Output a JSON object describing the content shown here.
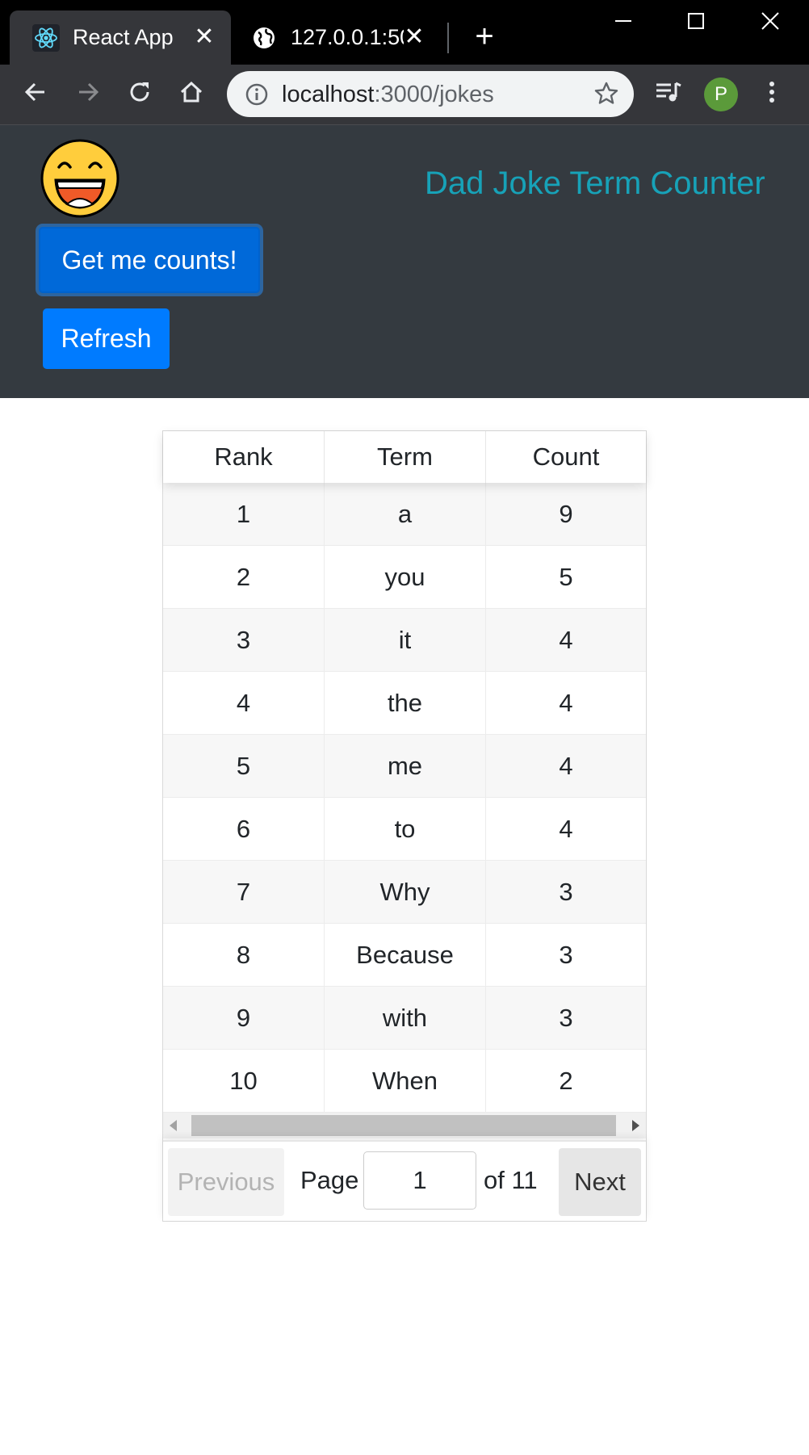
{
  "browser": {
    "tabs": [
      {
        "title": "React App",
        "icon": "react-icon",
        "active": true
      },
      {
        "title": "127.0.0.1:50",
        "icon": "globe-icon",
        "active": false
      }
    ],
    "url_host": "localhost",
    "url_path": ":3000/jokes",
    "profile_initial": "P"
  },
  "header": {
    "title": "Dad Joke Term Counter",
    "logo": "laughing-emoji-icon",
    "get_counts_label": "Get me counts!",
    "refresh_label": "Refresh",
    "title_color": "#17a2b8",
    "background_color": "#343a40",
    "button_color": "#007bff"
  },
  "table": {
    "columns": [
      "Rank",
      "Term",
      "Count"
    ],
    "rows": [
      {
        "rank": "1",
        "term": "a",
        "count": "9"
      },
      {
        "rank": "2",
        "term": "you",
        "count": "5"
      },
      {
        "rank": "3",
        "term": "it",
        "count": "4"
      },
      {
        "rank": "4",
        "term": "the",
        "count": "4"
      },
      {
        "rank": "5",
        "term": "me",
        "count": "4"
      },
      {
        "rank": "6",
        "term": "to",
        "count": "4"
      },
      {
        "rank": "7",
        "term": "Why",
        "count": "3"
      },
      {
        "rank": "8",
        "term": "Because",
        "count": "3"
      },
      {
        "rank": "9",
        "term": "with",
        "count": "3"
      },
      {
        "rank": "10",
        "term": "When",
        "count": "2"
      }
    ]
  },
  "pagination": {
    "previous_label": "Previous",
    "page_label": "Page",
    "current_page": "1",
    "of_label": "of 11",
    "next_label": "Next"
  }
}
